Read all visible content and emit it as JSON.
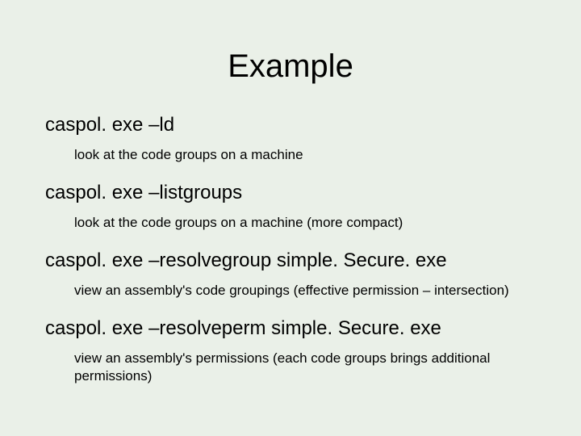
{
  "title": "Example",
  "items": [
    {
      "command": "caspol. exe –ld",
      "description": "look at the code groups on a machine"
    },
    {
      "command": "caspol. exe –listgroups",
      "description": "look at the code groups on a machine (more compact)"
    },
    {
      "command": "caspol. exe –resolvegroup simple. Secure. exe",
      "description": "view an assembly's code groupings  (effective permission – intersection)"
    },
    {
      "command": "caspol. exe –resolveperm simple. Secure. exe",
      "description": "view an assembly's permissions (each code groups brings additional permissions)"
    }
  ]
}
